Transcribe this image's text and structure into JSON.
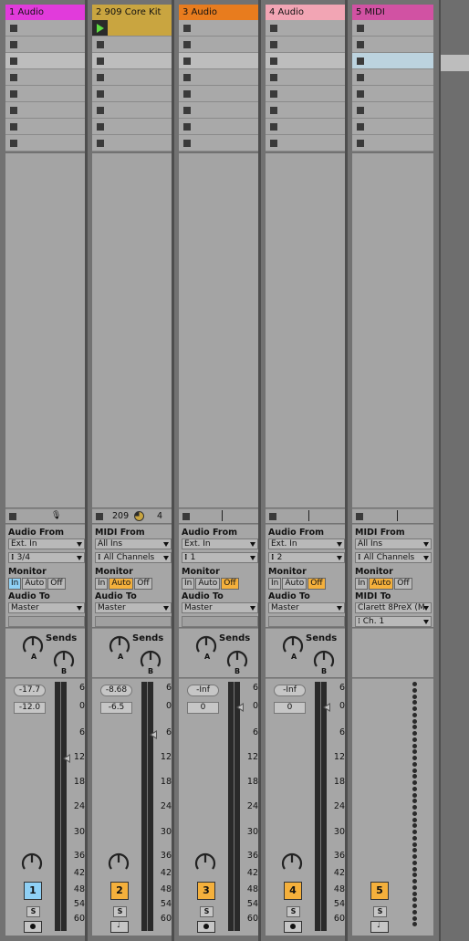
{
  "tracks": [
    {
      "name": "1 Audio",
      "color": "#e13bdb",
      "type": "audio",
      "io": {
        "from_label": "Audio From",
        "from_value": "Ext. In",
        "channel": "3/4",
        "monitor_label": "Monitor",
        "monitor": [
          "In",
          "Auto",
          "Off"
        ],
        "monitor_active": "In",
        "to_label": "Audio To",
        "to_value": "Master"
      },
      "stop_bar": {
        "extra": "mic-icon"
      },
      "mixer": {
        "volume": "-17.7",
        "pan": "-12.0",
        "number": "1",
        "number_color": "#8fd0f5",
        "solo": "S"
      }
    },
    {
      "name": "2 909 Core Kit",
      "color": "#c9a540",
      "type": "midi",
      "clip_playing": true,
      "io": {
        "from_label": "MIDI From",
        "from_value": "All Ins",
        "channel": "All Channels",
        "monitor_label": "Monitor",
        "monitor": [
          "In",
          "Auto",
          "Off"
        ],
        "monitor_active": "Auto",
        "to_label": "Audio To",
        "to_value": "Master"
      },
      "stop_bar": {
        "value1": "209",
        "value2": "4"
      },
      "mixer": {
        "volume": "-8.68",
        "pan": "-6.5",
        "number": "2",
        "number_color": "#f4b03c",
        "solo": "S"
      }
    },
    {
      "name": "3 Audio",
      "color": "#e87c1e",
      "type": "audio",
      "io": {
        "from_label": "Audio From",
        "from_value": "Ext. In",
        "channel": "1",
        "monitor_label": "Monitor",
        "monitor": [
          "In",
          "Auto",
          "Off"
        ],
        "monitor_active": "Off",
        "to_label": "Audio To",
        "to_value": "Master"
      },
      "mixer": {
        "volume": "-Inf",
        "pan": "0",
        "number": "3",
        "number_color": "#f4b03c",
        "solo": "S"
      }
    },
    {
      "name": "4 Audio",
      "color": "#f2a5b4",
      "type": "audio",
      "io": {
        "from_label": "Audio From",
        "from_value": "Ext. In",
        "channel": "2",
        "monitor_label": "Monitor",
        "monitor": [
          "In",
          "Auto",
          "Off"
        ],
        "monitor_active": "Off",
        "to_label": "Audio To",
        "to_value": "Master"
      },
      "mixer": {
        "volume": "-Inf",
        "pan": "0",
        "number": "4",
        "number_color": "#f4b03c",
        "solo": "S"
      }
    },
    {
      "name": "5 MIDI",
      "color": "#d152a3",
      "type": "midi",
      "io": {
        "from_label": "MIDI From",
        "from_value": "All Ins",
        "channel": "All Channels",
        "monitor_label": "Monitor",
        "monitor": [
          "In",
          "Auto",
          "Off"
        ],
        "monitor_active": "Auto",
        "to_label": "MIDI To",
        "to_value": "Clarett 8PreX (M",
        "to_channel": "Ch. 1"
      },
      "mixer": {
        "number": "5",
        "number_color": "#f4b03c",
        "solo": "S"
      }
    }
  ],
  "sends": {
    "label": "Sends",
    "knob_a": "A",
    "knob_b": "B"
  },
  "meter_scale": [
    "6",
    "0",
    "6",
    "12",
    "18",
    "24",
    "30",
    "36",
    "42",
    "48",
    "54",
    "60"
  ],
  "slot_rows": 8
}
